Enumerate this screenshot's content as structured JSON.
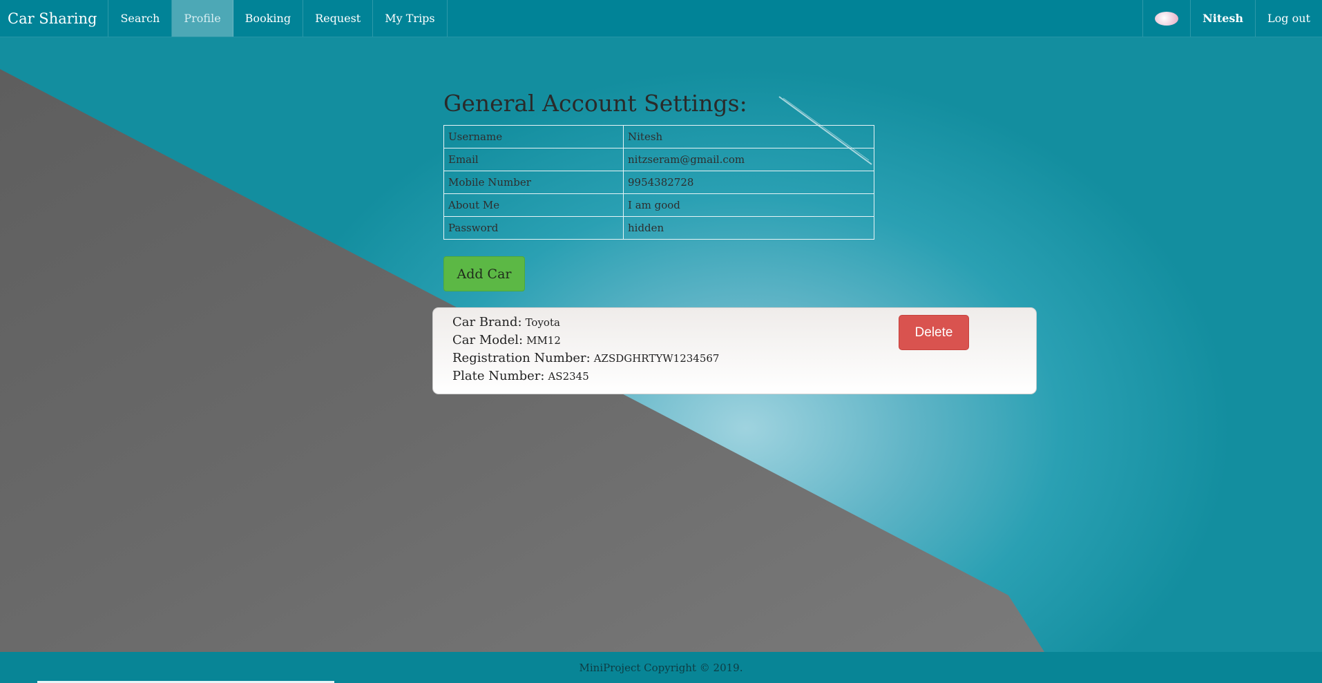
{
  "navbar": {
    "brand": "Car Sharing",
    "links": [
      {
        "label": "Search"
      },
      {
        "label": "Profile"
      },
      {
        "label": "Booking"
      },
      {
        "label": "Request"
      },
      {
        "label": "My Trips"
      }
    ],
    "active": "Profile",
    "user_name": "Nitesh",
    "logout_label": "Log out"
  },
  "settings": {
    "title": "General Account Settings:",
    "rows": [
      {
        "key": "Username",
        "value": "Nitesh"
      },
      {
        "key": "Email",
        "value": "nitzseram@gmail.com"
      },
      {
        "key": "Mobile Number",
        "value": "9954382728"
      },
      {
        "key": "About Me",
        "value": "I am good"
      },
      {
        "key": "Password",
        "value": "hidden"
      }
    ]
  },
  "add_car_label": "Add Car",
  "car": {
    "brand_label": "Car Brand:",
    "brand": "Toyota",
    "model_label": "Car Model:",
    "model": "MM12",
    "registration_label": "Registration Number:",
    "registration": "AZSDGHRTYW1234567",
    "plate_label": "Plate Number:",
    "plate": "AS2345",
    "delete_label": "Delete"
  },
  "footer": {
    "text": "MiniProject Copyright © 2019."
  },
  "colors": {
    "navbar": "#00829a",
    "add_button": "#5cb845",
    "delete_button": "#d9534f",
    "footer": "#088596"
  }
}
